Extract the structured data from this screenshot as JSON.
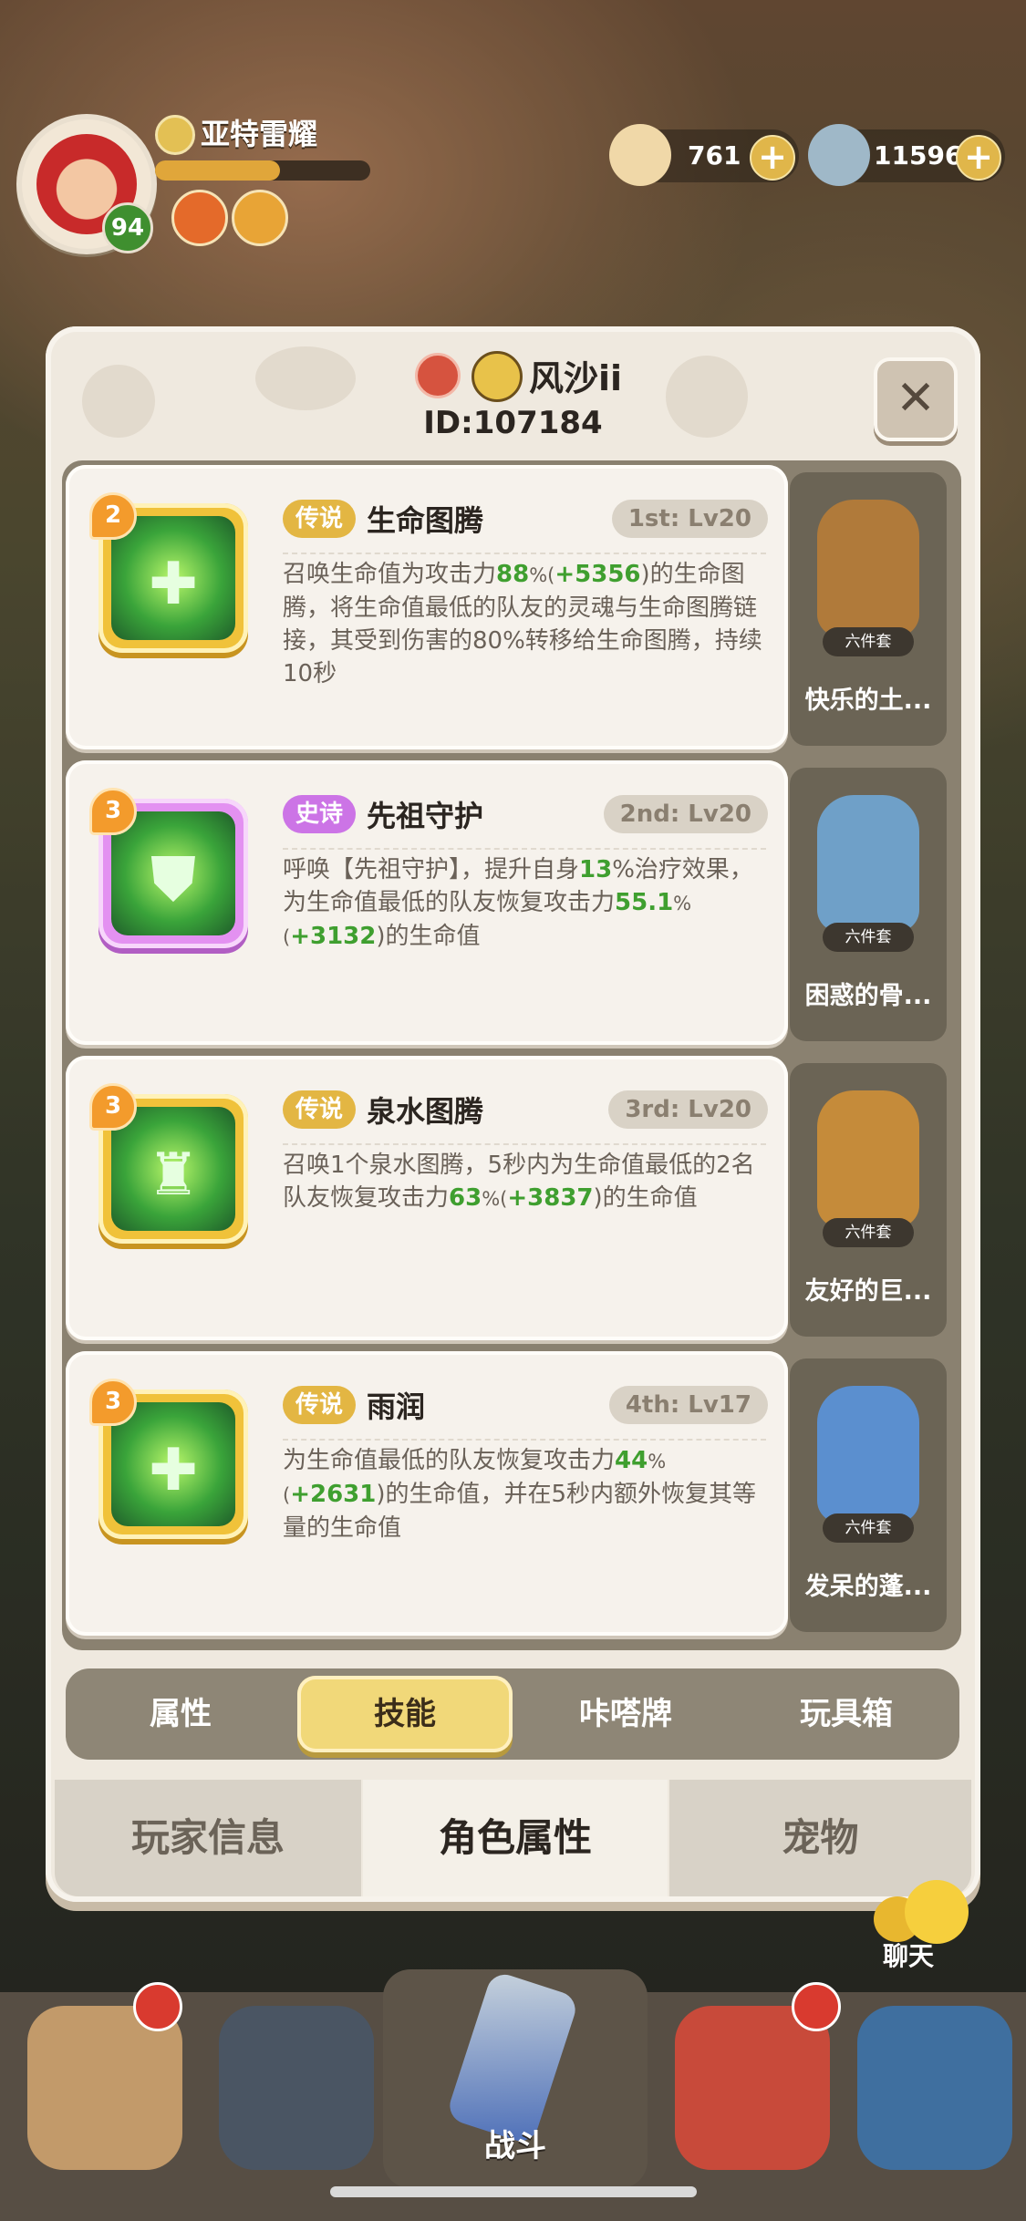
{
  "hud": {
    "player_name": "亚特雷耀",
    "level": "94",
    "xp_fraction": 0.58,
    "resource1": "761",
    "resource2": "115960",
    "plus": "+"
  },
  "panel": {
    "name": "风沙ii",
    "id": "ID:107184",
    "close": "✕"
  },
  "skills": [
    {
      "badge": "2",
      "rarity": "传说",
      "name": "生命图腾",
      "slot": "1st: Lv20",
      "glyph": "✚",
      "desc": [
        {
          "t": "召唤生命值为攻击力"
        },
        {
          "t": "88",
          "g": true
        },
        {
          "t": "%(",
          "p": true
        },
        {
          "t": "+5356",
          "g": true
        },
        {
          "t": ")的生命图腾，将生命值最低的队友的灵魂与生命图腾链接，其受到伤害的80%转移给生命图腾，持续10秒"
        }
      ],
      "companion": {
        "name": "快乐的土...",
        "set": "六件套",
        "color": "#b07a3a"
      }
    },
    {
      "badge": "3",
      "rarity": "史诗",
      "name": "先祖守护",
      "slot": "2nd: Lv20",
      "glyph": "⛊",
      "desc": [
        {
          "t": "呼唤【先祖守护】，提升自身"
        },
        {
          "t": "13",
          "g": true
        },
        {
          "t": "%治疗效果，为生命值最低的队友恢复攻击力"
        },
        {
          "t": "55.1",
          "g": true
        },
        {
          "t": "%(",
          "p": true
        },
        {
          "t": "+3132",
          "g": true
        },
        {
          "t": ")的生命值"
        }
      ],
      "companion": {
        "name": "困惑的骨...",
        "set": "六件套",
        "color": "#6fa0c8"
      }
    },
    {
      "badge": "3",
      "rarity": "传说",
      "name": "泉水图腾",
      "slot": "3rd: Lv20",
      "glyph": "♜",
      "desc": [
        {
          "t": "召唤1个泉水图腾，5秒内为生命值最低的2名队友恢复攻击力"
        },
        {
          "t": "63",
          "g": true
        },
        {
          "t": "%(",
          "p": true
        },
        {
          "t": "+3837",
          "g": true
        },
        {
          "t": ")的生命值"
        }
      ],
      "companion": {
        "name": "友好的巨...",
        "set": "六件套",
        "color": "#c58b3a"
      }
    },
    {
      "badge": "3",
      "rarity": "传说",
      "name": "雨润",
      "slot": "4th: Lv17",
      "glyph": "✚",
      "desc": [
        {
          "t": "为生命值最低的队友恢复攻击力"
        },
        {
          "t": "44",
          "g": true
        },
        {
          "t": "%(",
          "p": true
        },
        {
          "t": "+2631",
          "g": true
        },
        {
          "t": ")的生命值，并在5秒内额外恢复其等量的生命值"
        }
      ],
      "companion": {
        "name": "发呆的蓬...",
        "set": "六件套",
        "color": "#5b8fcf"
      }
    }
  ],
  "subtabs": [
    "属性",
    "技能",
    "咔嗒牌",
    "玩具箱"
  ],
  "maintabs": [
    "玩家信息",
    "角色属性",
    "宠物"
  ],
  "chat": "聊天",
  "battle": "战斗",
  "colors": {
    "legend": "#e3b643",
    "epic": "#cc74e6",
    "green": "#3f9f2f"
  }
}
